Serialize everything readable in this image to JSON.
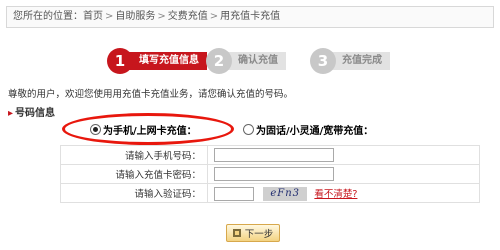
{
  "breadcrumb": {
    "prefix": "您所在的位置：",
    "items": [
      "首页",
      "自助服务",
      "交费充值",
      "用充值卡充值"
    ],
    "separator": ">"
  },
  "steps": [
    {
      "number": "1",
      "label": "填写充值信息",
      "state": "active"
    },
    {
      "number": "2",
      "label": "确认充值",
      "state": "inactive"
    },
    {
      "number": "3",
      "label": "充值完成",
      "state": "inactive"
    }
  ],
  "welcome_text": "尊敬的用户，欢迎您使用用充值卡充值业务，请您确认充值的号码。",
  "section": {
    "marker": "▸",
    "title": "号码信息"
  },
  "recharge_types": [
    {
      "label": "为手机/上网卡充值：",
      "checked": true
    },
    {
      "label": "为固话/小灵通/宽带充值：",
      "checked": false
    }
  ],
  "form": {
    "phone_label": "请输入手机号码：",
    "phone_value": "",
    "card_password_label": "请输入充值卡密码：",
    "card_password_value": "",
    "captcha_label": "请输入验证码：",
    "captcha_value": "",
    "captcha_image_text": "eFn3",
    "captcha_refresh_link": "看不清楚?"
  },
  "next_button": {
    "label": "下一步"
  },
  "colors": {
    "accent_red": "#c7161d",
    "highlight_ellipse": "#e8170d",
    "button_gold": "#f3d382"
  }
}
